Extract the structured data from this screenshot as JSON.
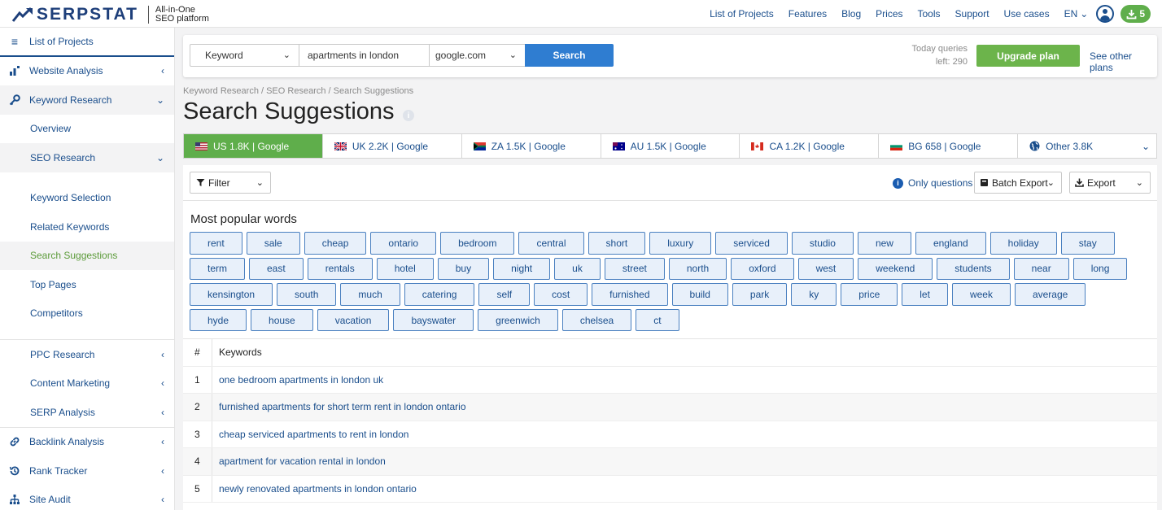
{
  "header": {
    "brand": "SERPSTAT",
    "tagline_line1": "All-in-One",
    "tagline_line2": "SEO platform",
    "nav": [
      "List of Projects",
      "Features",
      "Blog",
      "Prices",
      "Tools",
      "Support",
      "Use cases"
    ],
    "language": "EN",
    "downloads_count": "5"
  },
  "sidebar": {
    "items": [
      {
        "label": "List of Projects"
      },
      {
        "label": "Website Analysis"
      },
      {
        "label": "Keyword Research"
      },
      {
        "label": "Overview"
      },
      {
        "label": "SEO Research"
      },
      {
        "label": "Keyword Selection"
      },
      {
        "label": "Related Keywords"
      },
      {
        "label": "Search Suggestions"
      },
      {
        "label": "Top Pages"
      },
      {
        "label": "Competitors"
      },
      {
        "label": "PPC Research"
      },
      {
        "label": "Content Marketing"
      },
      {
        "label": "SERP Analysis"
      },
      {
        "label": "Backlink Analysis"
      },
      {
        "label": "Rank Tracker"
      },
      {
        "label": "Site Audit"
      }
    ]
  },
  "search": {
    "type": "Keyword",
    "query": "apartments in london",
    "engine": "google.com",
    "button": "Search",
    "queries_line1": "Today queries",
    "queries_line2": "left: 290",
    "upgrade": "Upgrade plan",
    "other_plans": "See other plans"
  },
  "breadcrumb": "Keyword Research / SEO Research / Search Suggestions",
  "page_title": "Search Suggestions",
  "tabs": [
    {
      "label": "US 1.8K | Google",
      "flag": "us"
    },
    {
      "label": "UK 2.2K | Google",
      "flag": "uk"
    },
    {
      "label": "ZA 1.5K | Google",
      "flag": "za"
    },
    {
      "label": "AU 1.5K | Google",
      "flag": "au"
    },
    {
      "label": "CA 1.2K | Google",
      "flag": "ca"
    },
    {
      "label": "BG 658 | Google",
      "flag": "bg"
    },
    {
      "label": "Other 3.8K",
      "flag": "globe"
    }
  ],
  "toolbar": {
    "filter": "Filter",
    "only_questions": "Only questions",
    "batch_export": "Batch Export",
    "export": "Export"
  },
  "popular_words_title": "Most popular words",
  "popular_words": [
    "rent",
    "sale",
    "cheap",
    "ontario",
    "bedroom",
    "central",
    "short",
    "luxury",
    "serviced",
    "studio",
    "new",
    "england",
    "holiday",
    "stay",
    "term",
    "east",
    "rentals",
    "hotel",
    "buy",
    "night",
    "uk",
    "street",
    "north",
    "oxford",
    "west",
    "weekend",
    "students",
    "near",
    "long",
    "kensington",
    "south",
    "much",
    "catering",
    "self",
    "cost",
    "furnished",
    "build",
    "park",
    "ky",
    "price",
    "let",
    "week",
    "average",
    "hyde",
    "house",
    "vacation",
    "bayswater",
    "greenwich",
    "chelsea",
    "ct"
  ],
  "table": {
    "col_num": "#",
    "col_keywords": "Keywords",
    "rows": [
      {
        "n": "1",
        "kw": "one bedroom apartments in london uk"
      },
      {
        "n": "2",
        "kw": "furnished apartments for short term rent in london ontario"
      },
      {
        "n": "3",
        "kw": "cheap serviced apartments to rent in london"
      },
      {
        "n": "4",
        "kw": "apartment for vacation rental in london"
      },
      {
        "n": "5",
        "kw": "newly renovated apartments in london ontario"
      }
    ]
  }
}
